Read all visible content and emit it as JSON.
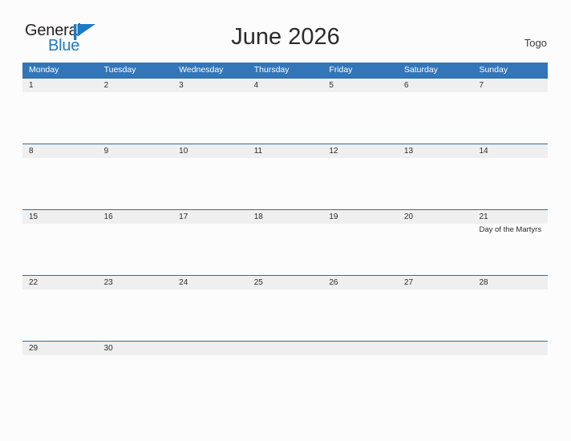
{
  "brand": {
    "name_part1": "General",
    "name_part2": "Blue",
    "flag_icon": "blue-flag-triangle-icon",
    "accent_color": "#1f7ac4",
    "text_color": "#231f20"
  },
  "header": {
    "title": "June 2026",
    "country": "Togo"
  },
  "colors": {
    "header_bar": "#3276b8",
    "row_band": "#efefef",
    "row_divider": "#2e6da4",
    "page_background": "#fcfcfd",
    "text": "#2b2b2b"
  },
  "weekday_headers": [
    "Monday",
    "Tuesday",
    "Wednesday",
    "Thursday",
    "Friday",
    "Saturday",
    "Sunday"
  ],
  "calendar": {
    "month": "June",
    "year": "2026",
    "first_weekday": "Monday",
    "days_in_month": 30,
    "weeks": [
      {
        "days": [
          {
            "num": "1",
            "event": ""
          },
          {
            "num": "2",
            "event": ""
          },
          {
            "num": "3",
            "event": ""
          },
          {
            "num": "4",
            "event": ""
          },
          {
            "num": "5",
            "event": ""
          },
          {
            "num": "6",
            "event": ""
          },
          {
            "num": "7",
            "event": ""
          }
        ]
      },
      {
        "days": [
          {
            "num": "8",
            "event": ""
          },
          {
            "num": "9",
            "event": ""
          },
          {
            "num": "10",
            "event": ""
          },
          {
            "num": "11",
            "event": ""
          },
          {
            "num": "12",
            "event": ""
          },
          {
            "num": "13",
            "event": ""
          },
          {
            "num": "14",
            "event": ""
          }
        ]
      },
      {
        "days": [
          {
            "num": "15",
            "event": ""
          },
          {
            "num": "16",
            "event": ""
          },
          {
            "num": "17",
            "event": ""
          },
          {
            "num": "18",
            "event": ""
          },
          {
            "num": "19",
            "event": ""
          },
          {
            "num": "20",
            "event": ""
          },
          {
            "num": "21",
            "event": "Day of the Martyrs"
          }
        ]
      },
      {
        "days": [
          {
            "num": "22",
            "event": ""
          },
          {
            "num": "23",
            "event": ""
          },
          {
            "num": "24",
            "event": ""
          },
          {
            "num": "25",
            "event": ""
          },
          {
            "num": "26",
            "event": ""
          },
          {
            "num": "27",
            "event": ""
          },
          {
            "num": "28",
            "event": ""
          }
        ]
      },
      {
        "days": [
          {
            "num": "29",
            "event": ""
          },
          {
            "num": "30",
            "event": ""
          },
          {
            "num": "",
            "event": ""
          },
          {
            "num": "",
            "event": ""
          },
          {
            "num": "",
            "event": ""
          },
          {
            "num": "",
            "event": ""
          },
          {
            "num": "",
            "event": ""
          }
        ]
      }
    ],
    "holidays": [
      {
        "date": "21",
        "name": "Day of the Martyrs"
      }
    ]
  }
}
